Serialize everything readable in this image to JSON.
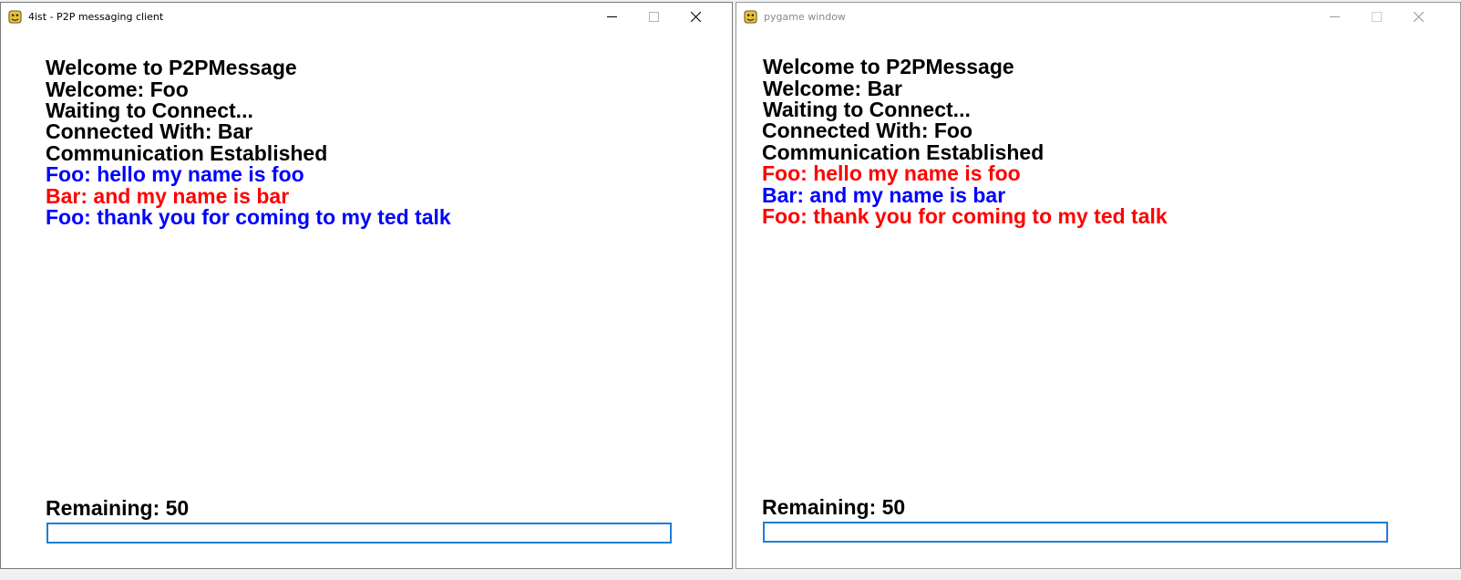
{
  "windows": [
    {
      "title": "4ist - P2P messaging client",
      "lines": [
        {
          "text": "Welcome to P2PMessage",
          "color": "#000000"
        },
        {
          "text": "Welcome: Foo",
          "color": "#000000"
        },
        {
          "text": "Waiting to Connect...",
          "color": "#000000"
        },
        {
          "text": "Connected With: Bar",
          "color": "#000000"
        },
        {
          "text": "Communication Established",
          "color": "#000000"
        },
        {
          "text": "Foo: hello my name is foo",
          "color": "#0000ff"
        },
        {
          "text": "Bar: and my name is bar",
          "color": "#ff0000"
        },
        {
          "text": "Foo: thank you for coming to my ted talk",
          "color": "#0000ff"
        }
      ],
      "remaining_label": "Remaining: 50",
      "input_value": ""
    },
    {
      "title": "pygame window",
      "lines": [
        {
          "text": "Welcome to P2PMessage",
          "color": "#000000"
        },
        {
          "text": "Welcome: Bar",
          "color": "#000000"
        },
        {
          "text": "Waiting to Connect...",
          "color": "#000000"
        },
        {
          "text": "Connected With: Foo",
          "color": "#000000"
        },
        {
          "text": "Communication Established",
          "color": "#000000"
        },
        {
          "text": "Foo: hello my name is foo",
          "color": "#ff0000"
        },
        {
          "text": "Bar: and my name is bar",
          "color": "#0000ff"
        },
        {
          "text": "Foo: thank you for coming to my ted talk",
          "color": "#ff0000"
        }
      ],
      "remaining_label": "Remaining: 50",
      "input_value": ""
    }
  ],
  "icons": {
    "app": "pygame-snake-icon",
    "minimize": "minimize-icon",
    "maximize": "maximize-icon",
    "close": "close-icon"
  },
  "colors": {
    "input_border": "#1e7fd4",
    "own_message": "#0000ff",
    "peer_message": "#ff0000"
  }
}
